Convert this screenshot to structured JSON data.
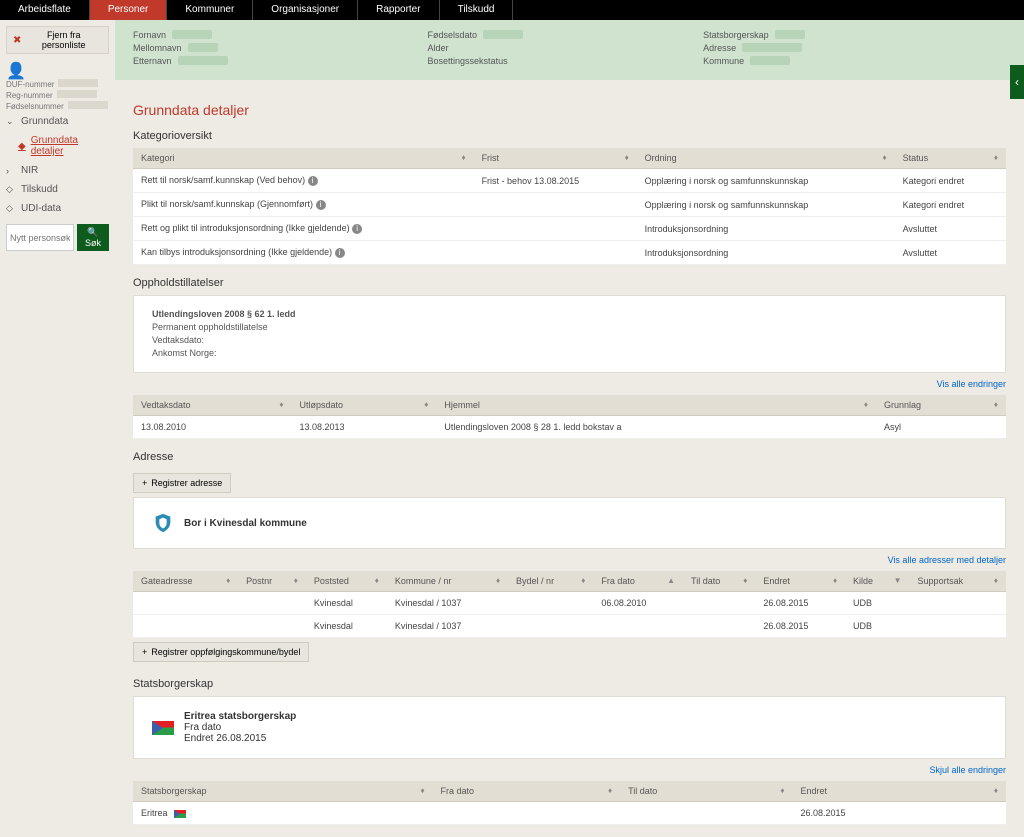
{
  "nav": {
    "items": [
      "Arbeidsflate",
      "Personer",
      "Kommuner",
      "Organisasjoner",
      "Rapporter",
      "Tilskudd"
    ],
    "active": 1
  },
  "sidebar": {
    "remove_btn": "Fjern fra personliste",
    "meta": {
      "duf": "DUF-nummer",
      "reg": "Reg-nummer",
      "fod": "Fødselsnummer"
    },
    "grunndata": "Grunndata",
    "grunndata_detaljer": "Grunndata detaljer",
    "nir": "NIR",
    "tilskudd": "Tilskudd",
    "udi": "UDI-data",
    "search_placeholder": "Nytt personsøk",
    "search_btn": "Søk"
  },
  "header": {
    "fornavn": "Fornavn",
    "mellomnavn": "Mellomnavn",
    "etternavn": "Etternavn",
    "fodselsdato": "Fødselsdato",
    "alder": "Alder",
    "bosetting": "Bosettingssekstatus",
    "statsborgerskap": "Statsborgerskap",
    "adresse": "Adresse",
    "kommune": "Kommune"
  },
  "main": {
    "title": "Grunndata detaljer",
    "kategori_title": "Kategorioversikt",
    "kat_headers": {
      "kategori": "Kategori",
      "frist": "Frist",
      "ordning": "Ordning",
      "status": "Status"
    },
    "kat_rows": [
      {
        "kategori": "Rett til norsk/samf.kunnskap (Ved behov)",
        "frist": "Frist - behov 13.08.2015",
        "ordning": "Opplæring i norsk og samfunnskunnskap",
        "status": "Kategori endret"
      },
      {
        "kategori": "Plikt til norsk/samf.kunnskap (Gjennomført)",
        "frist": "",
        "ordning": "Opplæring i norsk og samfunnskunnskap",
        "status": "Kategori endret"
      },
      {
        "kategori": "Rett og plikt til introduksjonsordning (Ikke gjeldende)",
        "frist": "",
        "ordning": "Introduksjonsordning",
        "status": "Avsluttet"
      },
      {
        "kategori": "Kan tilbys introduksjonsordning (Ikke gjeldende)",
        "frist": "",
        "ordning": "Introduksjonsordning",
        "status": "Avsluttet"
      }
    ],
    "opphold_title": "Oppholdstillatelser",
    "opphold_card": {
      "l1": "Utlendingsloven 2008 § 62 1. ledd",
      "l2": "Permanent oppholdstillatelse",
      "l3": "Vedtaksdato:",
      "l4": "Ankomst Norge:"
    },
    "vis_alle": "Vis alle endringer",
    "opphold_headers": {
      "vedtak": "Vedtaksdato",
      "utlop": "Utløpsdato",
      "hjemmel": "Hjemmel",
      "grunnlag": "Grunnlag"
    },
    "opphold_rows": [
      {
        "vedtak": "13.08.2010",
        "utlop": "13.08.2013",
        "hjemmel": "Utlendingsloven 2008 § 28 1. ledd bokstav a",
        "grunnlag": "Asyl"
      }
    ],
    "adresse_title": "Adresse",
    "registrer_adresse": "Registrer adresse",
    "bor_i": "Bor i Kvinesdal kommune",
    "vis_adr": "Vis alle adresser med detaljer",
    "adr_headers": {
      "gate": "Gateadresse",
      "postnr": "Postnr",
      "poststed": "Poststed",
      "kommune": "Kommune / nr",
      "bydel": "Bydel / nr",
      "fra": "Fra dato",
      "til": "Til dato",
      "endret": "Endret",
      "kilde": "Kilde",
      "support": "Supportsak"
    },
    "adr_rows": [
      {
        "gate": "",
        "postnr": "",
        "poststed": "Kvinesdal",
        "kommune": "Kvinesdal / 1037",
        "bydel": "",
        "fra": "06.08.2010",
        "til": "",
        "endret": "26.08.2015",
        "kilde": "UDB",
        "support": ""
      },
      {
        "gate": "",
        "postnr": "",
        "poststed": "Kvinesdal",
        "kommune": "Kvinesdal / 1037",
        "bydel": "",
        "fra": "",
        "til": "",
        "endret": "26.08.2015",
        "kilde": "UDB",
        "support": ""
      }
    ],
    "registrer_oppfolging": "Registrer oppfølgingskommune/bydel",
    "stats_title": "Statsborgerskap",
    "stats_card": {
      "l1": "Eritrea statsborgerskap",
      "l2": "Fra dato",
      "l3": "Endret 26.08.2015"
    },
    "skjul": "Skjul alle endringer",
    "stats_headers": {
      "stats": "Statsborgerskap",
      "fra": "Fra dato",
      "til": "Til dato",
      "endret": "Endret"
    },
    "stats_rows": [
      {
        "stats": "Eritrea",
        "fra": "",
        "til": "",
        "endret": "26.08.2015"
      }
    ]
  }
}
